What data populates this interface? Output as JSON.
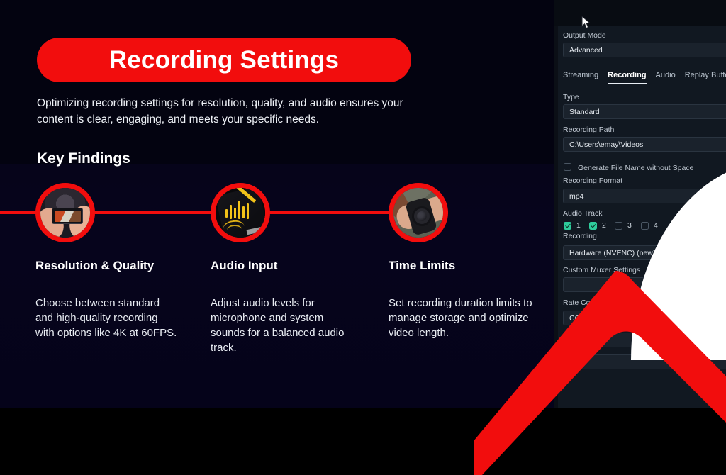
{
  "slide": {
    "title": "Recording Settings",
    "subtitle": "Optimizing recording settings for resolution, quality, and audio ensures your content is clear, engaging, and meets your specific needs.",
    "section_heading": "Key Findings",
    "accent_color": "#f20d0d",
    "background_color": "#05031a",
    "columns": [
      {
        "heading": "Resolution & Quality",
        "body": "Choose between standard and high-quality recording with options like 4K at 60FPS.",
        "icon": "phone-recording-photo"
      },
      {
        "heading": "Audio Input",
        "body": "Adjust audio levels for microphone and system sounds for a balanced audio track.",
        "icon": "audio-recorder-photo"
      },
      {
        "heading": "Time Limits",
        "body": "Set recording duration limits to manage storage and optimize video length.",
        "icon": "smartwatch-photo"
      }
    ]
  },
  "panel": {
    "output_mode_label": "Output Mode",
    "output_mode_value": "Advanced",
    "tabs": [
      {
        "label": "Streaming",
        "active": false
      },
      {
        "label": "Recording",
        "active": true
      },
      {
        "label": "Audio",
        "active": false
      },
      {
        "label": "Replay Buffer",
        "active": false
      }
    ],
    "type_label": "Type",
    "type_value": "Standard",
    "recording_path_label": "Recording Path",
    "recording_path_value": "C:\\Users\\emay\\Videos",
    "generate_file_name_label": "Generate File Name without Space",
    "generate_file_name_checked": false,
    "recording_format_label": "Recording Format",
    "recording_format_value": "mp4",
    "audio_track_label": "Audio Track",
    "audio_tracks": [
      {
        "number": "1",
        "checked": true
      },
      {
        "number": "2",
        "checked": true
      },
      {
        "number": "3",
        "checked": false
      },
      {
        "number": "4",
        "checked": false
      }
    ],
    "recording_encoder_label": "Recording",
    "recording_encoder_value": "Hardware (NVENC) (new)",
    "custom_muxer_label": "Custom Muxer Settings",
    "custom_muxer_value": "",
    "rate_control_label": "Rate Control",
    "rate_control_value": "CQP",
    "checkbox_on_color": "#2ecc9b"
  }
}
